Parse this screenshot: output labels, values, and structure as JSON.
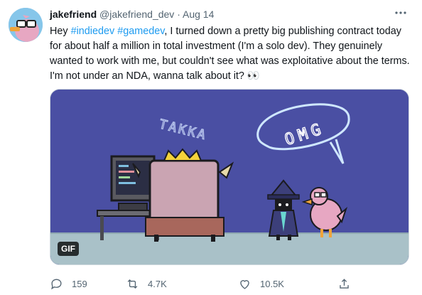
{
  "tweet": {
    "display_name": "jakefriend",
    "handle": "@jakefriend_dev",
    "separator": "·",
    "date": "Aug 14",
    "more_icon": "more-horizontal-icon",
    "text_parts": {
      "lead": "Hey ",
      "tag1": "#indiedev",
      "space": " ",
      "tag2": "#gamedev",
      "body": ", I turned down a pretty big publishing contract today for about half a million in total investment (I'm a solo dev). They genuinely wanted to work with me, but couldn't see what was exploitative about the terms. I'm not under an NDA, wanna talk about it? 👀"
    },
    "media": {
      "badge": "GIF",
      "scene_text_1": "TAKKA",
      "scene_text_2": "OMG"
    },
    "actions": {
      "reply_count": "159",
      "retweet_count": "4.7K",
      "like_count": "10.5K"
    }
  },
  "colors": {
    "hashtag": "#1d9bf0",
    "muted": "#536471",
    "media_bg": "#4a4fa3"
  }
}
